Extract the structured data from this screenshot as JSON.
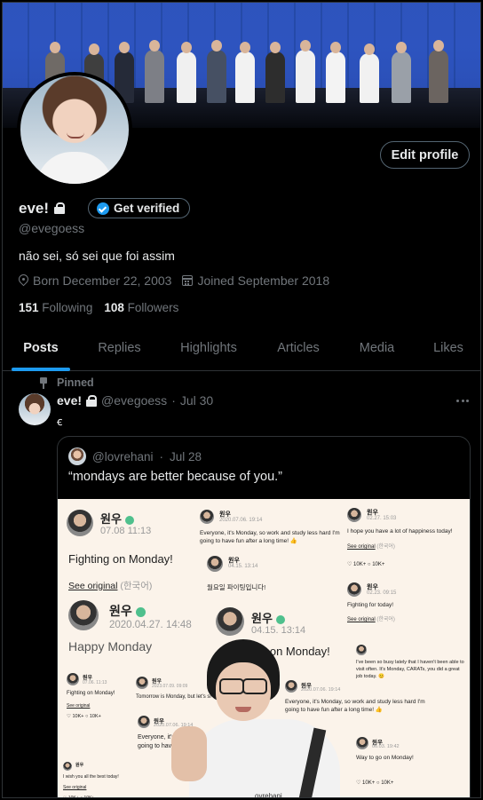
{
  "profile": {
    "display_name": "eve!",
    "handle": "@evegoess",
    "bio": "não sei, só sei que foi assim",
    "born": "Born December 22, 2003",
    "joined": "Joined September 2018",
    "following_count": "151",
    "following_label": "Following",
    "followers_count": "108",
    "followers_label": "Followers",
    "edit_profile_label": "Edit profile",
    "get_verified_label": "Get verified"
  },
  "tabs": [
    {
      "label": "Posts",
      "active": true
    },
    {
      "label": "Replies",
      "active": false
    },
    {
      "label": "Highlights",
      "active": false
    },
    {
      "label": "Articles",
      "active": false
    },
    {
      "label": "Media",
      "active": false
    },
    {
      "label": "Likes",
      "active": false
    }
  ],
  "pinned_post": {
    "pinned_label": "Pinned",
    "author_name": "eve!",
    "author_handle": "@evegoess",
    "date": "Jul 30",
    "separator": "·",
    "body": "ꞓ",
    "quote": {
      "handle": "@lovrehani",
      "date": "Jul 28",
      "text": "“mondays are better because of you.”",
      "image_cards": {
        "name": "원우",
        "big_date_1": "07.08 11:13",
        "big_msg_1": "Fighting on Monday!",
        "see_original": "See original",
        "korean": "(한국어)",
        "big_date_2": "2020.04.27. 14:48",
        "big_msg_2": "Happy Monday",
        "big_date_3": "04.15. 13:14",
        "big_msg_3": "o on Monday!",
        "s_date_1": "2020.07.06. 19:14",
        "s_msg_1": "Everyone, it's Monday, so work and study less hard I'm going to have fun after a long time! 👍",
        "s_date_2": "04.15. 13:14",
        "s_msg_2": "월요일 파이팅입니다!",
        "s_date_3": "02.27. 15:03",
        "s_msg_3": "I hope you have a lot of happiness today!",
        "s_likes": "10K+",
        "s_comments": "10K+",
        "s_date_4": "02.23. 09:15",
        "s_msg_4": "Fighting for today!",
        "s_msg_5": "I've been so busy lately that I haven't been able to visit often. It's Monday, CARATs, you did a great job today. 😊",
        "s_date_6": "07.06. 11:13",
        "s_msg_6": "Fighting on Monday!",
        "s_msg_7": "Tomorrow is Monday, but let's sl",
        "s_date_7": "2023.07.09. 09:09",
        "s_msg_8": "Everyone, it's Monday, so work and study less hard I'm going to have fun after a long time! 👍",
        "s_date_8": "2020.07.06. 19:14",
        "s_msg_9": "Everyone, it's Monday, so w I'm going to have fun after",
        "s_date_9": "2020.07.06. 19:14",
        "s_msg_10": "Way to go on Monday!",
        "s_date_10": "06.03. 19:42",
        "s_msg_11": "I wish you all the best today!",
        "watermark": "ovrehani"
      }
    }
  },
  "colors": {
    "background": "#000000",
    "text": "#e7e9ea",
    "muted": "#71767b",
    "accent": "#1d9bf0",
    "border": "#2f3336"
  }
}
